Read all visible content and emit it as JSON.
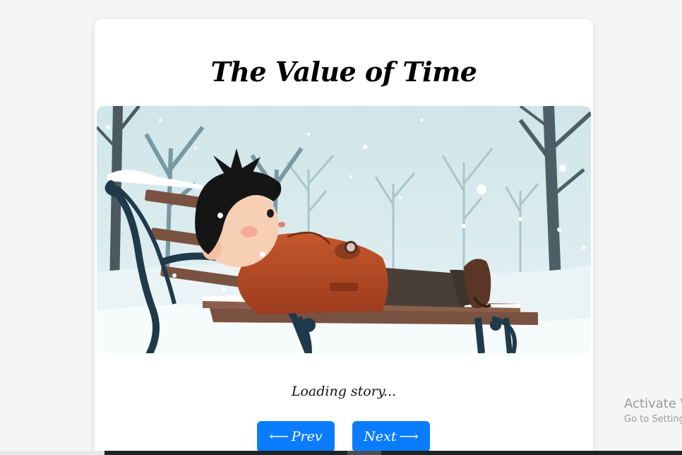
{
  "story": {
    "title": "The Value of Time",
    "status": "Loading story...",
    "illustration_alt": "Boy lying on a snowy park bench"
  },
  "nav": {
    "prev_label": "Prev",
    "next_label": "Next",
    "prev_arrow": "⟵",
    "next_arrow": "⟶",
    "accent": "#0a7cff"
  },
  "watermark": {
    "line1": "Activate Windows",
    "line2": "Go to Settings to activate Windows."
  }
}
